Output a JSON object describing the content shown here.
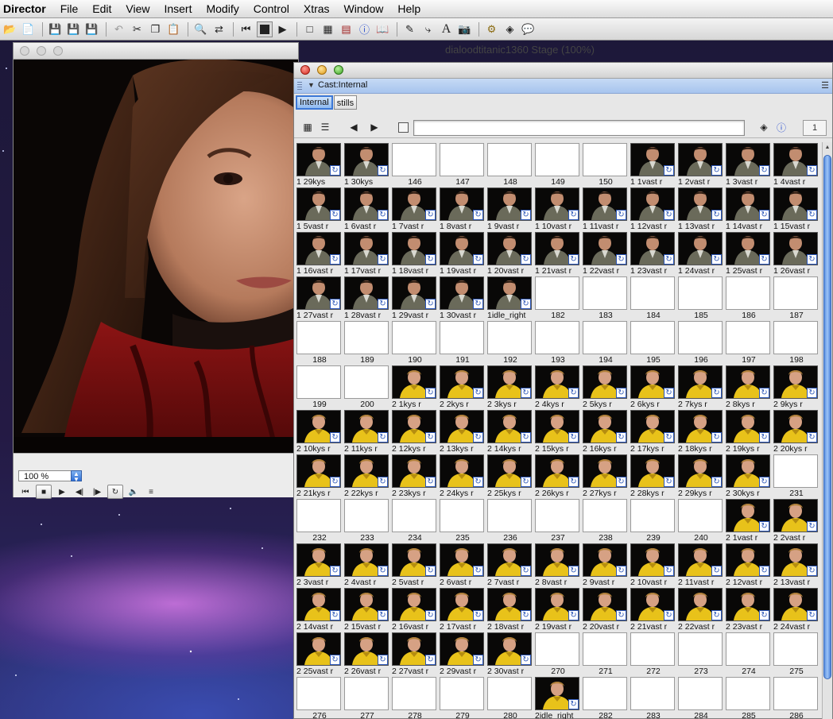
{
  "menubar": {
    "app": "Director",
    "items": [
      "File",
      "Edit",
      "View",
      "Insert",
      "Modify",
      "Control",
      "Xtras",
      "Window",
      "Help"
    ]
  },
  "toolbar": {
    "icons": [
      "open-icon",
      "import-icon",
      "save-icon",
      "save-all-icon",
      "publish-icon",
      "undo-icon",
      "cut-icon",
      "copy-icon",
      "paste-icon",
      "find-icon",
      "exchange-icon",
      "rewind-icon",
      "stop-icon",
      "play-icon",
      "stage-icon",
      "cast-icon",
      "score-icon",
      "inspector-icon",
      "library-icon",
      "paint-icon",
      "vector-icon",
      "text-icon",
      "script-icon",
      "behavior-icon",
      "properties-icon",
      "message-icon"
    ]
  },
  "stage": {
    "title": "dialoodtitanic1360 Stage (100%)",
    "zoom": "100 %"
  },
  "cast": {
    "title": "Cast:Internal",
    "tabs": [
      "Internal",
      "stills"
    ],
    "active_tab": "Internal",
    "member_number": "1",
    "members": [
      {
        "label": "1 29kys",
        "type": "man"
      },
      {
        "label": "1 30kys",
        "type": "man"
      },
      {
        "label": "146",
        "type": "empty"
      },
      {
        "label": "147",
        "type": "empty"
      },
      {
        "label": "148",
        "type": "empty"
      },
      {
        "label": "149",
        "type": "empty"
      },
      {
        "label": "150",
        "type": "empty"
      },
      {
        "label": "1 1vast r",
        "type": "man"
      },
      {
        "label": "1 2vast r",
        "type": "man"
      },
      {
        "label": "1 3vast r",
        "type": "man"
      },
      {
        "label": "1 4vast r",
        "type": "man"
      },
      {
        "label": "1 5vast r",
        "type": "man"
      },
      {
        "label": "1 6vast r",
        "type": "man"
      },
      {
        "label": "1 7vast r",
        "type": "man"
      },
      {
        "label": "1 8vast r",
        "type": "man"
      },
      {
        "label": "1 9vast r",
        "type": "man"
      },
      {
        "label": "1 10vast r",
        "type": "man"
      },
      {
        "label": "1 11vast r",
        "type": "man"
      },
      {
        "label": "1 12vast r",
        "type": "man"
      },
      {
        "label": "1 13vast r",
        "type": "man"
      },
      {
        "label": "1 14vast r",
        "type": "man"
      },
      {
        "label": "1 15vast r",
        "type": "man"
      },
      {
        "label": "1 16vast r",
        "type": "man"
      },
      {
        "label": "1 17vast r",
        "type": "man"
      },
      {
        "label": "1 18vast r",
        "type": "man"
      },
      {
        "label": "1 19vast r",
        "type": "man"
      },
      {
        "label": "1 20vast r",
        "type": "man"
      },
      {
        "label": "1 21vast r",
        "type": "man"
      },
      {
        "label": "1 22vast r",
        "type": "man"
      },
      {
        "label": "1 23vast r",
        "type": "man"
      },
      {
        "label": "1 24vast r",
        "type": "man"
      },
      {
        "label": "1 25vast r",
        "type": "man"
      },
      {
        "label": "1 26vast r",
        "type": "man"
      },
      {
        "label": "1 27vast r",
        "type": "man"
      },
      {
        "label": "1 28vast r",
        "type": "man"
      },
      {
        "label": "1 29vast r",
        "type": "man"
      },
      {
        "label": "1 30vast r",
        "type": "man"
      },
      {
        "label": "1idle_right",
        "type": "man"
      },
      {
        "label": "182",
        "type": "empty"
      },
      {
        "label": "183",
        "type": "empty"
      },
      {
        "label": "184",
        "type": "empty"
      },
      {
        "label": "185",
        "type": "empty"
      },
      {
        "label": "186",
        "type": "empty"
      },
      {
        "label": "187",
        "type": "empty"
      },
      {
        "label": "188",
        "type": "empty"
      },
      {
        "label": "189",
        "type": "empty"
      },
      {
        "label": "190",
        "type": "empty"
      },
      {
        "label": "191",
        "type": "empty"
      },
      {
        "label": "192",
        "type": "empty"
      },
      {
        "label": "193",
        "type": "empty"
      },
      {
        "label": "194",
        "type": "empty"
      },
      {
        "label": "195",
        "type": "empty"
      },
      {
        "label": "196",
        "type": "empty"
      },
      {
        "label": "197",
        "type": "empty"
      },
      {
        "label": "198",
        "type": "empty"
      },
      {
        "label": "199",
        "type": "empty"
      },
      {
        "label": "200",
        "type": "empty"
      },
      {
        "label": "2 1kys r",
        "type": "boy"
      },
      {
        "label": "2 2kys r",
        "type": "boy"
      },
      {
        "label": "2 3kys r",
        "type": "boy"
      },
      {
        "label": "2 4kys r",
        "type": "boy"
      },
      {
        "label": "2 5kys r",
        "type": "boy"
      },
      {
        "label": "2 6kys r",
        "type": "boy"
      },
      {
        "label": "2 7kys r",
        "type": "boy"
      },
      {
        "label": "2 8kys r",
        "type": "boy"
      },
      {
        "label": "2 9kys r",
        "type": "boy"
      },
      {
        "label": "2 10kys r",
        "type": "boy"
      },
      {
        "label": "2 11kys r",
        "type": "boy"
      },
      {
        "label": "2 12kys r",
        "type": "boy"
      },
      {
        "label": "2 13kys r",
        "type": "boy"
      },
      {
        "label": "2 14kys r",
        "type": "boy"
      },
      {
        "label": "2 15kys r",
        "type": "boy"
      },
      {
        "label": "2 16kys r",
        "type": "boy"
      },
      {
        "label": "2 17kys r",
        "type": "boy"
      },
      {
        "label": "2 18kys r",
        "type": "boy"
      },
      {
        "label": "2 19kys r",
        "type": "boy"
      },
      {
        "label": "2 20kys r",
        "type": "boy"
      },
      {
        "label": "2 21kys r",
        "type": "boy"
      },
      {
        "label": "2 22kys r",
        "type": "boy"
      },
      {
        "label": "2 23kys r",
        "type": "boy"
      },
      {
        "label": "2 24kys r",
        "type": "boy"
      },
      {
        "label": "2 25kys r",
        "type": "boy"
      },
      {
        "label": "2 26kys r",
        "type": "boy"
      },
      {
        "label": "2 27kys r",
        "type": "boy"
      },
      {
        "label": "2 28kys r",
        "type": "boy"
      },
      {
        "label": "2 29kys r",
        "type": "boy"
      },
      {
        "label": "2 30kys r",
        "type": "boy"
      },
      {
        "label": "231",
        "type": "empty"
      },
      {
        "label": "232",
        "type": "empty"
      },
      {
        "label": "233",
        "type": "empty"
      },
      {
        "label": "234",
        "type": "empty"
      },
      {
        "label": "235",
        "type": "empty"
      },
      {
        "label": "236",
        "type": "empty"
      },
      {
        "label": "237",
        "type": "empty"
      },
      {
        "label": "238",
        "type": "empty"
      },
      {
        "label": "239",
        "type": "empty"
      },
      {
        "label": "240",
        "type": "empty"
      },
      {
        "label": "2 1vast r",
        "type": "boy"
      },
      {
        "label": "2 2vast r",
        "type": "boy"
      },
      {
        "label": "2 3vast r",
        "type": "boy"
      },
      {
        "label": "2 4vast r",
        "type": "boy"
      },
      {
        "label": "2 5vast r",
        "type": "boy"
      },
      {
        "label": "2 6vast r",
        "type": "boy"
      },
      {
        "label": "2 7vast r",
        "type": "boy"
      },
      {
        "label": "2 8vast r",
        "type": "boy"
      },
      {
        "label": "2 9vast r",
        "type": "boy"
      },
      {
        "label": "2 10vast r",
        "type": "boy"
      },
      {
        "label": "2 11vast r",
        "type": "boy"
      },
      {
        "label": "2 12vast r",
        "type": "boy"
      },
      {
        "label": "2 13vast r",
        "type": "boy"
      },
      {
        "label": "2 14vast r",
        "type": "boy"
      },
      {
        "label": "2 15vast r",
        "type": "boy"
      },
      {
        "label": "2 16vast r",
        "type": "boy"
      },
      {
        "label": "2 17vast r",
        "type": "boy"
      },
      {
        "label": "2 18vast r",
        "type": "boy"
      },
      {
        "label": "2 19vast r",
        "type": "boy"
      },
      {
        "label": "2 20vast r",
        "type": "boy"
      },
      {
        "label": "2 21vast r",
        "type": "boy"
      },
      {
        "label": "2 22vast r",
        "type": "boy"
      },
      {
        "label": "2 23vast r",
        "type": "boy"
      },
      {
        "label": "2 24vast r",
        "type": "boy"
      },
      {
        "label": "2 25vast r",
        "type": "boy"
      },
      {
        "label": "2 26vast r",
        "type": "boy"
      },
      {
        "label": "2 27vast r",
        "type": "boy"
      },
      {
        "label": "2 29vast r",
        "type": "boy"
      },
      {
        "label": "2 30vast r",
        "type": "boy"
      },
      {
        "label": "270",
        "type": "empty"
      },
      {
        "label": "271",
        "type": "empty"
      },
      {
        "label": "272",
        "type": "empty"
      },
      {
        "label": "273",
        "type": "empty"
      },
      {
        "label": "274",
        "type": "empty"
      },
      {
        "label": "275",
        "type": "empty"
      },
      {
        "label": "276",
        "type": "empty"
      },
      {
        "label": "277",
        "type": "empty"
      },
      {
        "label": "278",
        "type": "empty"
      },
      {
        "label": "279",
        "type": "empty"
      },
      {
        "label": "280",
        "type": "empty"
      },
      {
        "label": "2idle_right",
        "type": "boy"
      },
      {
        "label": "282",
        "type": "empty"
      },
      {
        "label": "283",
        "type": "empty"
      },
      {
        "label": "284",
        "type": "empty"
      },
      {
        "label": "285",
        "type": "empty"
      },
      {
        "label": "286",
        "type": "empty"
      }
    ]
  },
  "colors": {
    "selection_blue": "#3b77d6",
    "man_jacket": "#6a6a5a",
    "boy_shirt": "#e8c21a",
    "scarf_red": "#8c1414"
  }
}
